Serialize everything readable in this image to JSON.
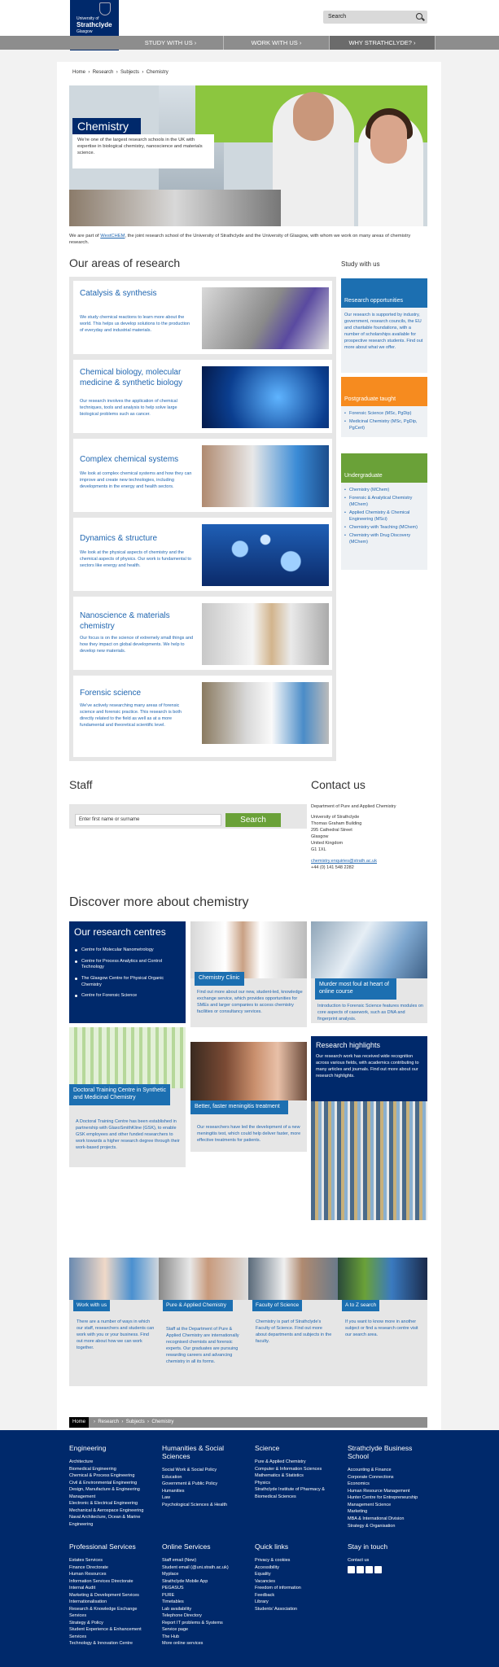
{
  "header": {
    "logo_small": "University of",
    "logo_main": "Strathclyde",
    "logo_sub": "Glasgow",
    "search_placeholder": "Search"
  },
  "nav": [
    "STUDY WITH US",
    "WORK WITH US",
    "WHY STRATHCLYDE?"
  ],
  "breadcrumb": [
    "Home",
    "Research",
    "Subjects",
    "Chemistry"
  ],
  "hero": {
    "title": "Chemistry",
    "intro": "We're one of the largest research schools in the UK with expertise in biological chemistry, nanoscience and materials science."
  },
  "westchem": {
    "pre": "We are part of ",
    "link": "WestCHEM",
    "post": ", the joint research school of the University of Strathclyde and the University of Glasgow, with whom we work on many areas of chemistry research."
  },
  "areas": {
    "heading": "Our areas of research",
    "items": [
      {
        "title": "Catalysis & synthesis",
        "desc": "We study chemical reactions to learn more about the world. This helps us develop solutions to the production of everyday and industrial materials."
      },
      {
        "title": "Chemical biology, molecular medicine & synthetic biology",
        "desc": "Our research involves the application of chemical techniques, tools and analysis to help solve large biological problems such as cancer."
      },
      {
        "title": "Complex chemical systems",
        "desc": "We look at complex chemical systems and how they can improve and create new technologies, including developments in the energy and health sectors."
      },
      {
        "title": "Dynamics & structure",
        "desc": "We look at the physical aspects of chemistry and the chemical aspects of physics. Our work is fundamental to sectors like energy and health."
      },
      {
        "title": "Nanoscience & materials chemistry",
        "desc": "Our focus is on the science of extremely small things and how they impact on global developments. We help to develop new materials."
      },
      {
        "title": "Forensic science",
        "desc": "We've actively researching many areas of forensic science and forensic practice. This research is both directly related to the field as well as at a more fundamental and theoretical scientific level."
      }
    ]
  },
  "sidebar": {
    "heading": "Study with us",
    "research": {
      "title": "Research opportunities",
      "text": "Our research is supported by industry, government, research councils, the EU and charitable foundations, with a number of scholarships available for prospective research students. Find out more about what we offer."
    },
    "postgrad": {
      "title": "Postgraduate taught",
      "items": [
        "Forensic Science (MSc, PgDip)",
        "Medicinal Chemistry (MSc, PgDip, PgCert)"
      ]
    },
    "undergrad": {
      "title": "Undergraduate",
      "items": [
        "Chemistry (MChem)",
        "Forensic & Analytical Chemistry (MChem)",
        "Applied Chemistry & Chemical Engineering (MSci)",
        "Chemistry with Teaching (MChem)",
        "Chemistry with Drug Discovery (MChem)"
      ]
    }
  },
  "staff": {
    "heading": "Staff",
    "placeholder": "Enter first name or surname",
    "button": "Search"
  },
  "contact": {
    "heading": "Contact us",
    "lines": [
      "Department of Pure and Applied Chemistry",
      "",
      "University of Strathclyde",
      "Thomas Graham Building",
      "295 Cathedral Street",
      "Glasgow",
      "United Kingdom",
      "G1 1XL"
    ],
    "email": "chemistry.enquiries@strath.ac.uk",
    "phone": "+44 (0) 141 548 2282"
  },
  "discover": {
    "heading": "Discover more about chemistry",
    "centres": {
      "title": "Our research centres",
      "items": [
        "Centre for Molecular Nanometrology",
        "Centre for Process Analytics and Control Technology",
        "The Glasgow Centre for Physical Organic Chemistry",
        "Centre for Forensic Science"
      ]
    },
    "clinic": {
      "title": "Chemistry Clinic",
      "text": "Find out more about our new, student-led, knowledge exchange service, which provides opportunities for SMEs and larger companies to access chemistry facilities or consultancy services."
    },
    "murder": {
      "title": "Murder most foul at heart of online course",
      "text": "Introduction to Forensic Science features modules on core aspects of casework, such as DNA and fingerprint analysis."
    },
    "doctoral": {
      "title": "Doctoral Training Centre in Synthetic and Medicinal Chemistry",
      "text": "A Doctoral Training Centre has been established in partnership with GlaxoSmithKline (GSK), to enable GSK employees and other funded researchers to work towards a higher research degree through their work-based projects."
    },
    "meningitis": {
      "title": "Better, faster meningitis treatment",
      "text": "Our researchers have led the development of a new meningitis test, which could help deliver faster, more effective treatments for patients."
    },
    "highlights": {
      "title": "Research highlights",
      "text": "Our research work has received wide recognition across various fields, with academics contributing to many articles and journals. Find out more about our research highlights."
    }
  },
  "bottom": [
    {
      "title": "Work with us",
      "text": "There are a number of ways in which our staff, researchers and students can work with you or your business. Find out more about how we can work together."
    },
    {
      "title": "Pure & Applied Chemistry",
      "text": "Staff at the Department of Pure & Applied Chemistry are internationally recognised chemists and forensic experts. Our graduates are pursuing rewarding careers and advancing chemistry in all its forms."
    },
    {
      "title": "Faculty of Science",
      "text": "Chemistry is part of Strathclyde's Faculty of Science. Find out more about departments and subjects in the faculty."
    },
    {
      "title": "A to Z search",
      "text": "If you want to know more in another subject or find a research centre visit our search area."
    }
  ],
  "footer_crumb": [
    "Home",
    "Research",
    "Subjects",
    "Chemistry"
  ],
  "footer": {
    "engineering": {
      "title": "Engineering",
      "items": [
        "Architecture",
        "Biomedical Engineering",
        "Chemical & Process Engineering",
        "Civil & Environmental Engineering",
        "Design, Manufacture & Engineering Management",
        "Electronic & Electrical Engineering",
        "Mechanical & Aerospace Engineering",
        "Naval Architecture, Ocean & Marine Engineering"
      ]
    },
    "hass": {
      "title": "Humanities & Social Sciences",
      "items": [
        "Social Work & Social Policy",
        "Education",
        "Government & Public Policy",
        "Humanities",
        "Law",
        "Psychological Sciences & Health"
      ]
    },
    "science": {
      "title": "Science",
      "items": [
        "Pure & Applied Chemistry",
        "Computer & Information Sciences",
        "Mathematics & Statistics",
        "Physics",
        "Strathclyde Institute of Pharmacy & Biomedical Sciences"
      ]
    },
    "business": {
      "title": "Strathclyde Business School",
      "items": [
        "Accounting & Finance",
        "Corporate Connections",
        "Economics",
        "Human Resource Management",
        "Hunter Centre for Entrepreneurship",
        "Management Science",
        "Marketing",
        "MBA & International Division",
        "Strategy & Organisation"
      ]
    },
    "professional": {
      "title": "Professional Services",
      "items": [
        "Estates Services",
        "Finance Directorate",
        "Human Resources",
        "Information Services Directorate",
        "Internal Audit",
        "Marketing & Development Services",
        "Internationalisation",
        "Research & Knowledge Exchange Services",
        "Strategy & Policy",
        "Student Experience & Enhancement Services",
        "Technology & Innovation Centre"
      ]
    },
    "online": {
      "title": "Online Services",
      "items": [
        "Staff email (New)",
        "Student email (@uni.strath.ac.uk)",
        "Myplace",
        "Strathclyde Mobile App",
        "PEGASUS",
        "PURE",
        "Timetables",
        "Lab availability",
        "Telephone Directory",
        "Report IT problems & Systems",
        "Service page",
        "The Hub",
        "More online services"
      ]
    },
    "quick": {
      "title": "Quick links",
      "items": [
        "Privacy & cookies",
        "Accessibility",
        "Equality",
        "Vacancies",
        "Freedom of information",
        "Feedback",
        "Library",
        "Students' Association"
      ]
    },
    "touch": {
      "title": "Stay in touch",
      "contact": "Contact us"
    }
  },
  "colors": {
    "navy": "#00296b",
    "blue_label": "#1c6fb1",
    "orange": "#f68b1f",
    "green": "#6aa138",
    "link": "#2066b0"
  }
}
